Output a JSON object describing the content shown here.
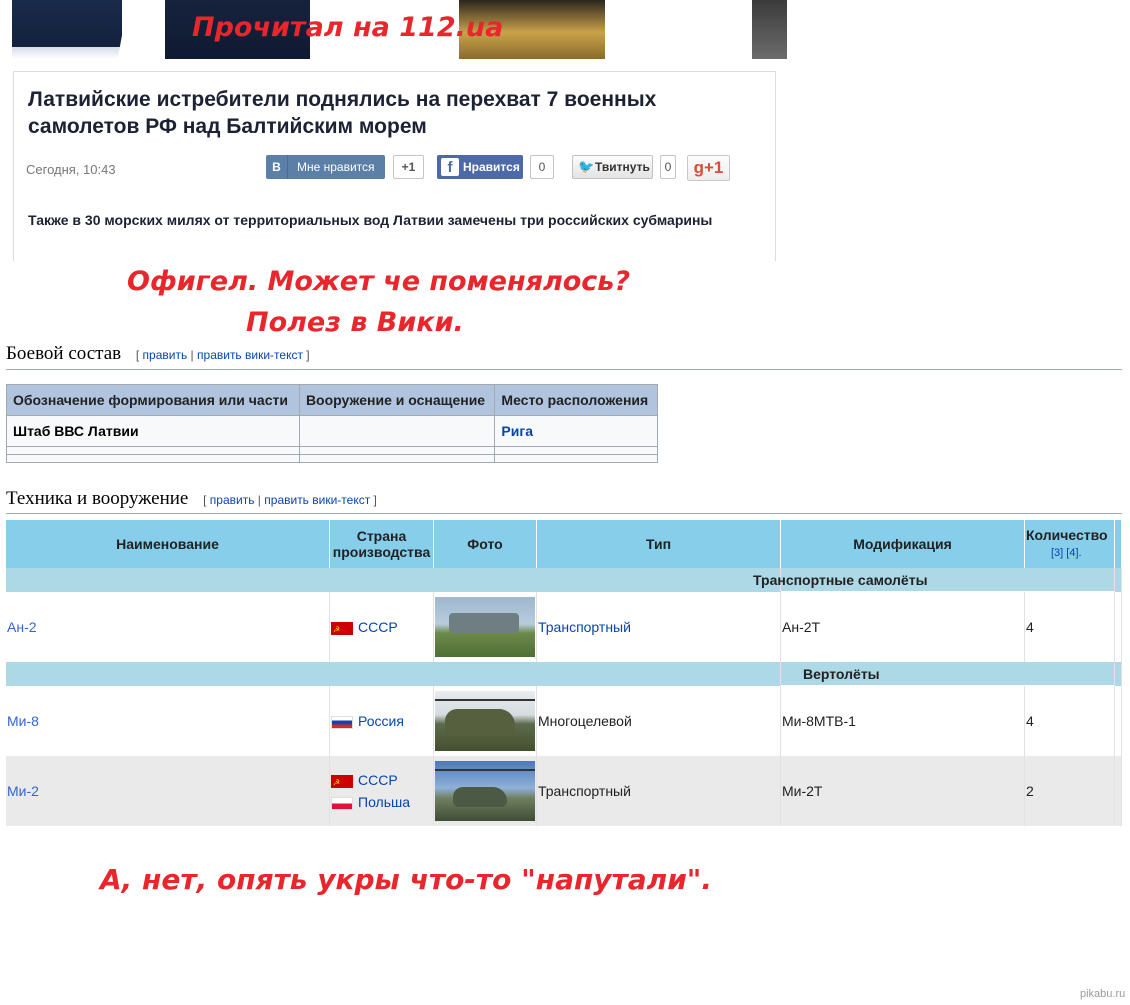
{
  "annotations": {
    "a1": "Прочитал на 112.ua",
    "a2": "Офигел. Может че поменялось?",
    "a3": "Полез в Вики.",
    "a4": "А, нет, опять укры что-то \"напутали\"."
  },
  "news": {
    "title": "Латвийские истребители поднялись на перехват 7 военных самолетов РФ над Балтийским морем",
    "date": "Сегодня, 10:43",
    "lead": "Также в 30 морских милях от территориальных вод Латвии замечены три российских субмарины",
    "social": {
      "vk_icon": "В",
      "vk_label": "Мне нравится",
      "vk_count": "+1",
      "fb_icon": "f",
      "fb_label": "Нравится",
      "fb_count": "0",
      "tw_label": "Твитнуть",
      "tw_count": "0",
      "gp_label": "g+1"
    }
  },
  "section1": {
    "heading": "Боевой состав",
    "edit_open": "[ ",
    "edit1": "править",
    "sep": " | ",
    "edit2": "править вики-текст",
    "edit_close": " ]",
    "columns": [
      "Обозначение формирования или части",
      "Вооружение и оснащение",
      "Место расположения"
    ],
    "rows": [
      {
        "unit": "Штаб ВВС Латвии",
        "equipment": "",
        "location": "Рига"
      }
    ]
  },
  "section2": {
    "heading": "Техника и вооружение",
    "edit_open": "[ ",
    "edit1": "править",
    "sep": " | ",
    "edit2": "править вики-текст",
    "edit_close": " ]",
    "columns": {
      "name": "Наименование",
      "country": "Страна производства",
      "photo": "Фото",
      "type": "Тип",
      "modification": "Модификация",
      "quantity": "Количество",
      "refs": "[3] [4]",
      "refs_dot": "."
    },
    "categories": {
      "transport": "Транспортные самолёты",
      "helicopters": "Вертолёты"
    },
    "rows": [
      {
        "name": "Ан-2",
        "country1": "СССР",
        "country2": "",
        "type": "Транспортный",
        "modification": "Ан-2Т",
        "quantity": "4"
      },
      {
        "name": "Ми-8",
        "country1": "Россия",
        "country2": "",
        "type": "Многоцелевой",
        "modification": "Ми-8МТВ-1",
        "quantity": "4"
      },
      {
        "name": "Ми-2",
        "country1": "СССР",
        "country2": "Польша",
        "type": "Транспортный",
        "modification": "Ми-2Т",
        "quantity": "2"
      }
    ]
  },
  "watermark": "pikabu.ru"
}
